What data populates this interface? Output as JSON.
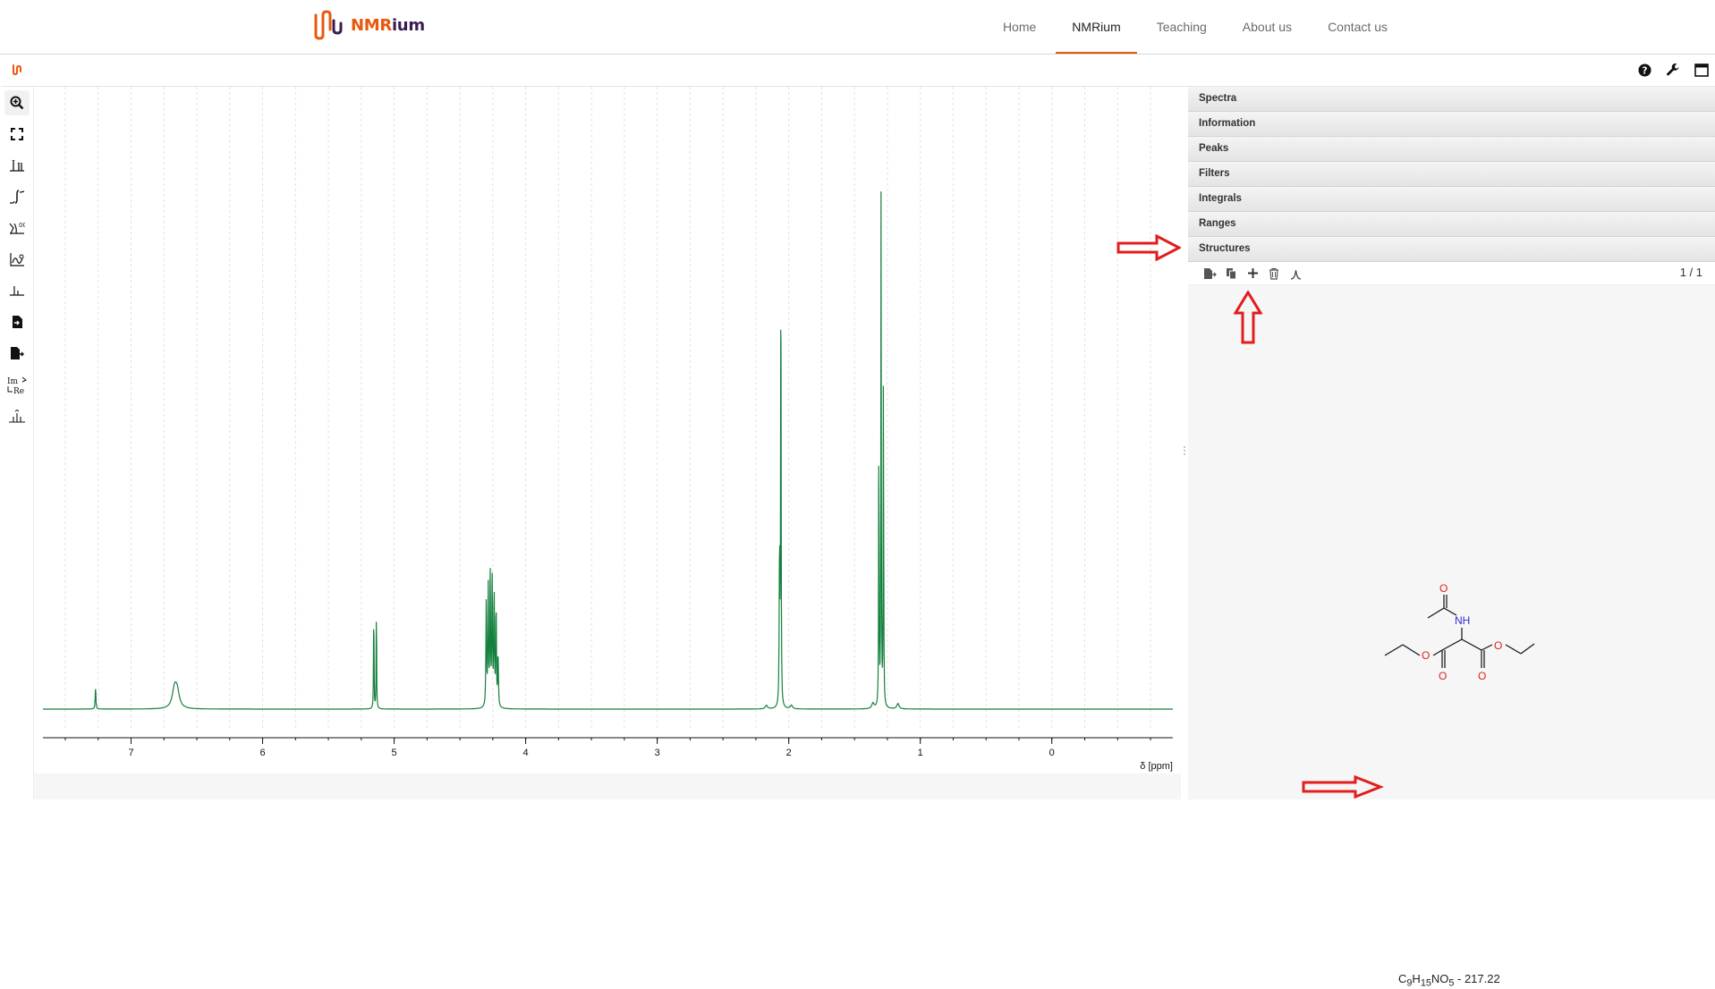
{
  "site": {
    "logo": {
      "text_nmr": "NMR",
      "text_ium": "ium"
    },
    "nav": [
      {
        "label": "Home",
        "active": false
      },
      {
        "label": "NMRium",
        "active": true
      },
      {
        "label": "Teaching",
        "active": false
      },
      {
        "label": "About us",
        "active": false
      },
      {
        "label": "Contact us",
        "active": false
      }
    ]
  },
  "app": {
    "header_actions": [
      "help-icon",
      "wrench-icon",
      "fullscreen-icon"
    ],
    "toolbar": [
      "zoom-in-icon",
      "full-view-icon",
      "peak-picking-icon",
      "integral-icon",
      "zero-filling-icon",
      "phase-correction-icon",
      "baseline-correction-icon",
      "import-icon",
      "export-icon",
      "real-imaginary-icon",
      "multiplet-analysis-icon"
    ]
  },
  "spectrum": {
    "axis_label": "δ [ppm]",
    "ticks": [
      "7",
      "6",
      "5",
      "4",
      "3",
      "2",
      "1",
      "0"
    ],
    "line_color": "#15803d"
  },
  "panels": {
    "sections": [
      {
        "label": "Spectra"
      },
      {
        "label": "Information"
      },
      {
        "label": "Peaks"
      },
      {
        "label": "Filters"
      },
      {
        "label": "Integrals"
      },
      {
        "label": "Ranges"
      },
      {
        "label": "Structures"
      }
    ],
    "structures": {
      "toolbar": [
        "export-molfile-icon",
        "copy-icon",
        "add-icon",
        "delete-icon",
        "predict-spectrum-icon"
      ],
      "pager": "1 / 1",
      "atoms": {
        "o_top": "O",
        "nh": "NH",
        "o_left": "O",
        "o_right": "O",
        "o_bottom_left": "O",
        "o_bottom_right": "O"
      },
      "formula": {
        "c": "C",
        "c_count": "9",
        "h": "H",
        "h_count": "15",
        "rest": "NO",
        "o_count": "5",
        "mass": " - 217.22"
      }
    }
  },
  "colors": {
    "accent": "#ea580c",
    "spectrum": "#15803d",
    "annotation": "#e11d1d"
  }
}
